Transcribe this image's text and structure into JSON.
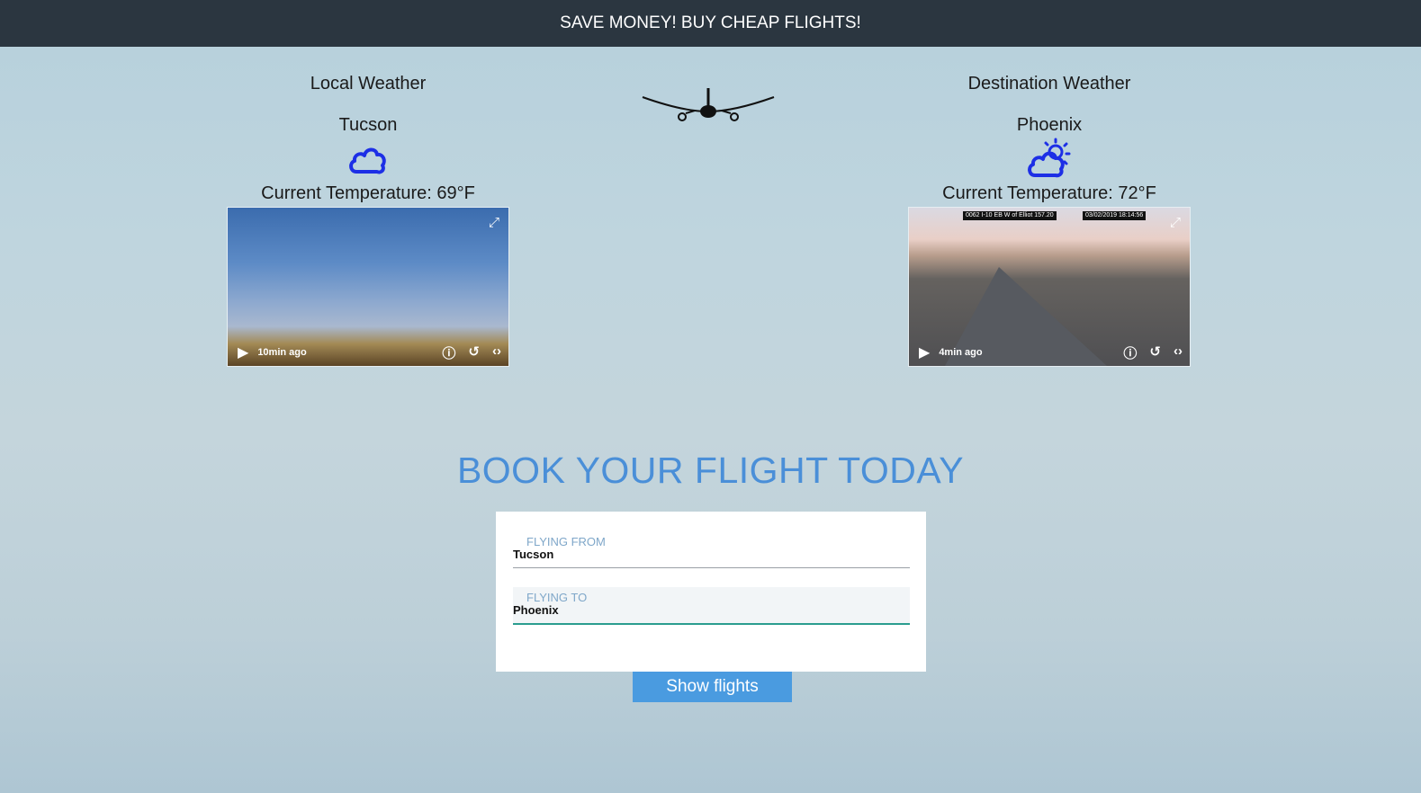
{
  "header": {
    "banner": "SAVE MONEY! BUY CHEAP FLIGHTS!"
  },
  "local": {
    "heading": "Local Weather",
    "city": "Tucson",
    "icon": "cloud-icon",
    "temperature": "Current Temperature: 69°F",
    "webcam": {
      "ago": "10min ago"
    }
  },
  "destination": {
    "heading": "Destination Weather",
    "city": "Phoenix",
    "icon": "cloud-sun-icon",
    "temperature": "Current Temperature: 72°F",
    "webcam": {
      "ago": "4min ago",
      "caption_left": "0062 I-10 EB W of Elliot 157.20",
      "caption_right": "03/02/2019 18:14:56"
    }
  },
  "booking": {
    "title": "BOOK YOUR FLIGHT TODAY",
    "from_label": "FLYING FROM",
    "from_value": "Tucson",
    "to_label": "FLYING TO",
    "to_value": "Phoenix",
    "submit_label": "Show flights"
  },
  "colors": {
    "header_bg": "#2b3640",
    "accent": "#4a9be0",
    "title": "#4a8fd8",
    "weather_icon": "#1d2fe6"
  }
}
